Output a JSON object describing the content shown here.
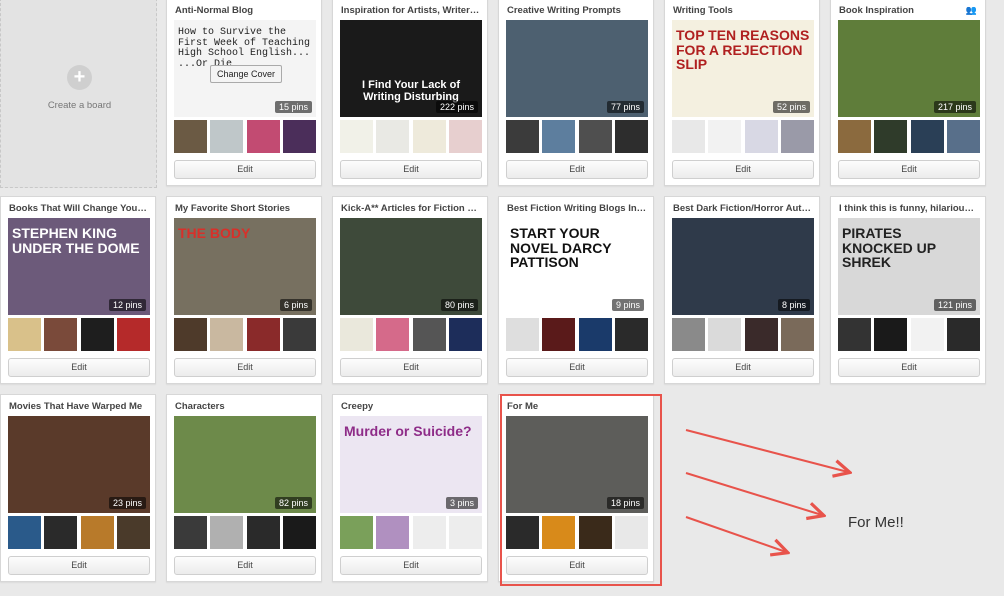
{
  "create_board": {
    "label": "Create a board",
    "icon": "plus-icon"
  },
  "change_cover_label": "Change Cover",
  "edit_label": "Edit",
  "annotation_text": "For Me!!",
  "colors": {
    "highlight": "#e8534b",
    "background": "#e9e9e9"
  },
  "boards": [
    {
      "title": "Anti-Normal Blog",
      "pins": "15 pins",
      "cover_text": "How to Survive the First Week of Teaching High School English... ...Or Die",
      "cover_bg": "#f4f4f4",
      "cover_fg": "#222",
      "thumbs": [
        "#6b5a44",
        "#bfc7c9",
        "#c24b72",
        "#4b2e5a"
      ]
    },
    {
      "title": "Inspiration for Artists, Writers,...",
      "pins": "222 pins",
      "cover_text": "I Find Your Lack of Writing Disturbing",
      "cover_bg": "#1a1a1a",
      "cover_fg": "#fff",
      "thumbs": [
        "#f1f1e8",
        "#e9e9e4",
        "#eeeadb",
        "#e7cfcf"
      ]
    },
    {
      "title": "Creative Writing Prompts",
      "pins": "77 pins",
      "cover_text": "",
      "cover_bg": "#4d6070",
      "cover_fg": "#fff",
      "thumbs": [
        "#3b3b3b",
        "#5d7e9e",
        "#4f4f4f",
        "#2d2d2d"
      ]
    },
    {
      "title": "Writing Tools",
      "pins": "52 pins",
      "cover_text": "TOP TEN REASONS FOR A REJECTION SLIP",
      "cover_bg": "#f4f0e0",
      "cover_fg": "#b02020",
      "thumbs": [
        "#e8e8e8",
        "#f2f2f2",
        "#d8d8e4",
        "#9a9aa8"
      ]
    },
    {
      "title": "Book Inspiration",
      "pins": "217 pins",
      "cover_text": "",
      "cover_bg": "#5f7d3a",
      "cover_fg": "#fff",
      "thumbs": [
        "#8b6a3e",
        "#2f3b2a",
        "#2a3f56",
        "#586f8a"
      ]
    },
    {
      "title": "Books That Will Change Your Life",
      "pins": "12 pins",
      "cover_text": "STEPHEN KING UNDER THE DOME",
      "cover_bg": "#6c5a7a",
      "cover_fg": "#fff",
      "thumbs": [
        "#d9c18a",
        "#7a4a3a",
        "#1e1e1e",
        "#b52a2a"
      ]
    },
    {
      "title": "My Favorite Short Stories",
      "pins": "6 pins",
      "cover_text": "THE BODY",
      "cover_bg": "#777060",
      "cover_fg": "#d8302a",
      "thumbs": [
        "#4e3a2a",
        "#c9b8a0",
        "#8a2a2a",
        "#3a3a3a"
      ]
    },
    {
      "title": "Kick-A** Articles for Fiction W...",
      "pins": "80 pins",
      "cover_text": "",
      "cover_bg": "#3e4a3a",
      "cover_fg": "#fff",
      "thumbs": [
        "#eae8dc",
        "#d56a8a",
        "#555555",
        "#1d2d5a"
      ]
    },
    {
      "title": "Best Fiction Writing Blogs In th...",
      "pins": "9 pins",
      "cover_text": "START YOUR NOVEL DARCY PATTISON",
      "cover_bg": "#ffffff",
      "cover_fg": "#111",
      "thumbs": [
        "#dedede",
        "#5a1a1a",
        "#1a3a6a",
        "#2a2a2a"
      ]
    },
    {
      "title": "Best Dark Fiction/Horror Auth...",
      "pins": "8 pins",
      "cover_text": "",
      "cover_bg": "#2f3a4a",
      "cover_fg": "#fff",
      "thumbs": [
        "#8a8a8a",
        "#dadada",
        "#3a2a2a",
        "#7a6a5a"
      ]
    },
    {
      "title": "I think this is funny, hilarious, ...",
      "pins": "121 pins",
      "cover_text": "PIRATES KNOCKED UP SHREK",
      "cover_bg": "#d8d8d8",
      "cover_fg": "#222",
      "thumbs": [
        "#333333",
        "#1a1a1a",
        "#f2f2f2",
        "#2a2a2a"
      ]
    },
    {
      "title": "Movies That Have Warped Me",
      "pins": "23 pins",
      "cover_text": "",
      "cover_bg": "#5a3a2a",
      "cover_fg": "#fff",
      "thumbs": [
        "#2a5a8a",
        "#2a2a2a",
        "#b87a2a",
        "#4a3a2a"
      ]
    },
    {
      "title": "Characters",
      "pins": "82 pins",
      "cover_text": "",
      "cover_bg": "#6d8a4a",
      "cover_fg": "#fff",
      "thumbs": [
        "#3a3a3a",
        "#b0b0b0",
        "#2a2a2a",
        "#1a1a1a"
      ]
    },
    {
      "title": "Creepy",
      "pins": "3 pins",
      "cover_text": "Murder or Suicide?",
      "cover_bg": "#ece6f2",
      "cover_fg": "#8e2c88",
      "thumbs": [
        "#7aa05a",
        "#b090c0",
        "#ededed",
        "#ededed"
      ]
    },
    {
      "title": "For Me",
      "pins": "18 pins",
      "cover_text": "",
      "cover_bg": "#5d5d5a",
      "cover_fg": "#fff",
      "thumbs": [
        "#2a2a2a",
        "#d88a1a",
        "#3a2a1a",
        "#e8e8e8"
      ]
    }
  ]
}
